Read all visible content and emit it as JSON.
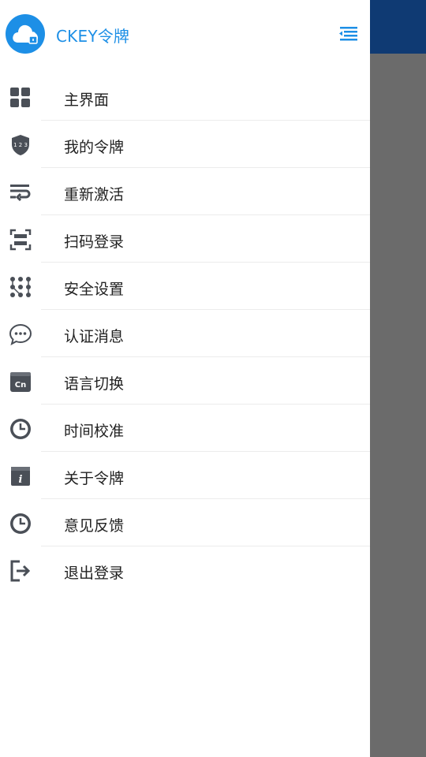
{
  "drawer": {
    "title": "CKEY令牌",
    "logo_icon": "cloud-lock-icon",
    "collapse_icon": "menu-collapse-icon",
    "accent_color": "#1d8fe6"
  },
  "menu": [
    {
      "label": "主界面",
      "icon": "dashboard-grid-icon"
    },
    {
      "label": "我的令牌",
      "icon": "shield-123-icon"
    },
    {
      "label": "重新激活",
      "icon": "reactivate-icon"
    },
    {
      "label": "扫码登录",
      "icon": "scan-icon"
    },
    {
      "label": "安全设置",
      "icon": "pattern-lock-icon"
    },
    {
      "label": "认证消息",
      "icon": "chat-bubble-icon"
    },
    {
      "label": "语言切换",
      "icon": "language-cn-icon"
    },
    {
      "label": "时间校准",
      "icon": "clock-icon"
    },
    {
      "label": "关于令牌",
      "icon": "info-icon"
    },
    {
      "label": "意见反馈",
      "icon": "feedback-clock-icon"
    },
    {
      "label": "退出登录",
      "icon": "logout-icon"
    }
  ],
  "background": {
    "appbar_color": "#0f3a73",
    "overlay_color": "#6b6b6b"
  }
}
